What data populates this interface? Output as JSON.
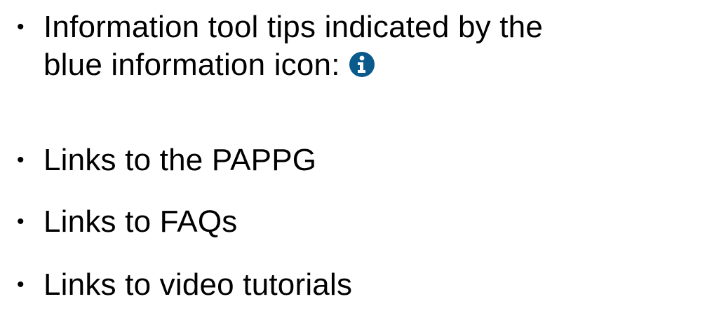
{
  "bullets": [
    {
      "text_line1": "Information tool tips indicated by the",
      "text_line2": "blue information icon:",
      "icon": "info-icon",
      "icon_color": "#0a5a8c"
    },
    {
      "text": "Links to the PAPPG"
    },
    {
      "text": "Links to FAQs"
    },
    {
      "text": "Links to video tutorials"
    }
  ],
  "bullet_glyph": "•"
}
